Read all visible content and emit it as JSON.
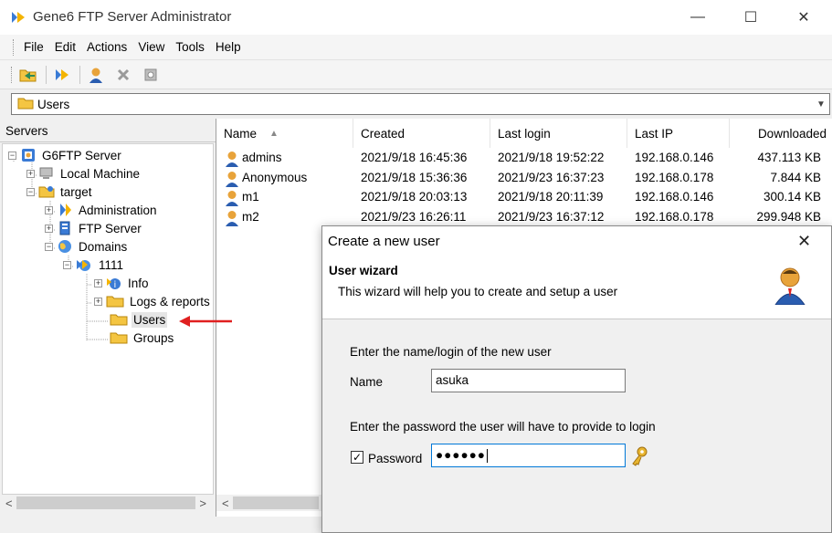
{
  "window": {
    "title": "Gene6 FTP Server Administrator",
    "controls": {
      "minimize": "—",
      "maximize": "☐",
      "close": "✕"
    }
  },
  "menu": [
    "File",
    "Edit",
    "Actions",
    "View",
    "Tools",
    "Help"
  ],
  "toolbar": [
    "open-folder-icon",
    "refresh-icon",
    "user-icon",
    "delete-icon",
    "properties-icon"
  ],
  "address": {
    "text": "Users",
    "icon": "folder-icon"
  },
  "left_panel": {
    "header": "Servers",
    "tree": [
      {
        "label": "G6FTP Server",
        "icon": "server-icon",
        "expander": "−",
        "level": 0
      },
      {
        "label": "Local Machine",
        "icon": "computer-icon",
        "expander": "+",
        "level": 1
      },
      {
        "label": "target",
        "icon": "folder-icon",
        "expander": "−",
        "level": 1
      },
      {
        "label": "Administration",
        "icon": "admin-icon",
        "expander": "+",
        "level": 2
      },
      {
        "label": "FTP Server",
        "icon": "ftp-server-icon",
        "expander": "+",
        "level": 2
      },
      {
        "label": "Domains",
        "icon": "globe-icon",
        "expander": "−",
        "level": 2
      },
      {
        "label": "1111",
        "icon": "domain-icon",
        "expander": "−",
        "level": 3
      },
      {
        "label": "Info",
        "icon": "info-icon",
        "expander": "+",
        "level": 4
      },
      {
        "label": "Logs & reports",
        "icon": "folder-icon",
        "expander": "+",
        "level": 4
      },
      {
        "label": "Users",
        "icon": "folder-icon",
        "expander": "",
        "level": 4,
        "selected": true
      },
      {
        "label": "Groups",
        "icon": "folder-icon",
        "expander": "",
        "level": 4
      }
    ],
    "scroll_left": "<",
    "scroll_right": ">"
  },
  "list": {
    "columns": [
      "Name",
      "Created",
      "Last login",
      "Last IP",
      "Downloaded"
    ],
    "sort_indicator": "▲",
    "rows": [
      {
        "name": "admins",
        "created": "2021/9/18 16:45:36",
        "last_login": "2021/9/18 19:52:22",
        "last_ip": "192.168.0.146",
        "downloaded": "437.113 KB"
      },
      {
        "name": "Anonymous",
        "created": "2021/9/18 15:36:36",
        "last_login": "2021/9/23 16:37:23",
        "last_ip": "192.168.0.178",
        "downloaded": "7.844 KB"
      },
      {
        "name": "m1",
        "created": "2021/9/18 20:03:13",
        "last_login": "2021/9/18 20:11:39",
        "last_ip": "192.168.0.146",
        "downloaded": "300.14 KB"
      },
      {
        "name": "m2",
        "created": "2021/9/23 16:26:11",
        "last_login": "2021/9/23 16:37:12",
        "last_ip": "192.168.0.178",
        "downloaded": "299.948 KB"
      }
    ],
    "scroll_left": "<"
  },
  "dialog": {
    "title": "Create a new user",
    "close": "✕",
    "header_title": "User wizard",
    "header_desc": "This wizard will help you to create and setup a user",
    "name_prompt": "Enter the name/login of the new user",
    "name_label": "Name",
    "name_value": "asuka",
    "password_prompt": "Enter the password the user will have to provide to login",
    "password_label": "Password",
    "password_checked": true,
    "password_mask": "●●●●●●"
  },
  "colors": {
    "accent_blue": "#0078d7",
    "annotation_arrow": "#e02020",
    "folder": "#f4c542",
    "user_head": "#e8a33a",
    "user_body": "#2a5db0"
  }
}
